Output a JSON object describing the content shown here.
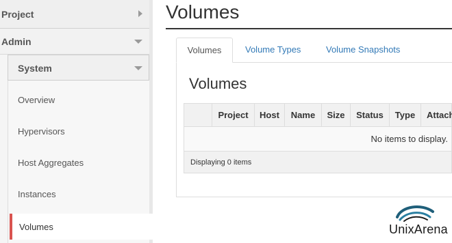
{
  "sidebar": {
    "project_label": "Project",
    "admin_label": "Admin",
    "system_label": "System",
    "items": [
      {
        "label": "Overview"
      },
      {
        "label": "Hypervisors"
      },
      {
        "label": "Host Aggregates"
      },
      {
        "label": "Instances"
      },
      {
        "label": "Volumes"
      }
    ],
    "active_color": "#d9534f"
  },
  "main": {
    "page_title": "Volumes",
    "tabs": [
      {
        "label": "Volumes"
      },
      {
        "label": "Volume Types"
      },
      {
        "label": "Volume Snapshots"
      }
    ],
    "section_title": "Volumes",
    "table": {
      "columns": [
        "",
        "Project",
        "Host",
        "Name",
        "Size",
        "Status",
        "Type",
        "Attach"
      ],
      "empty_message": "No items to display.",
      "footer": "Displaying 0 items"
    }
  },
  "watermark": {
    "brand": "UnixArena",
    "icon": "unixarena-logo-icon"
  }
}
